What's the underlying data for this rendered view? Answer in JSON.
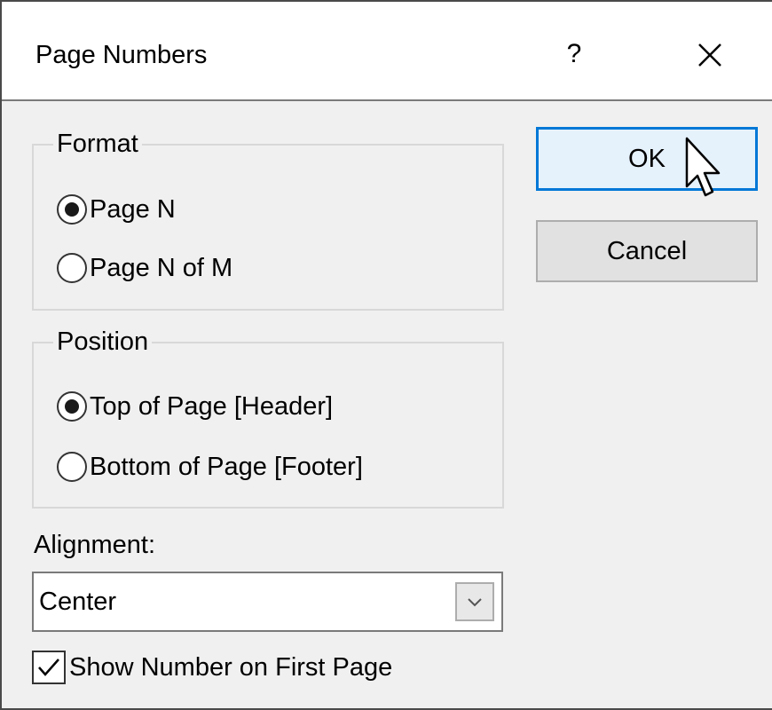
{
  "dialog": {
    "title": "Page Numbers",
    "help_label": "?",
    "close_icon": "close-icon"
  },
  "format_group": {
    "label": "Format",
    "options": [
      {
        "label": "Page N",
        "checked": true
      },
      {
        "label": "Page N of M",
        "checked": false
      }
    ]
  },
  "position_group": {
    "label": "Position",
    "options": [
      {
        "label": "Top of Page [Header]",
        "checked": true
      },
      {
        "label": "Bottom of Page [Footer]",
        "checked": false
      }
    ]
  },
  "alignment": {
    "label": "Alignment:",
    "value": "Center",
    "arrow_icon": "chevron-down-icon"
  },
  "show_first_page": {
    "label": "Show Number on First Page",
    "checked": true
  },
  "buttons": {
    "ok": "OK",
    "cancel": "Cancel"
  },
  "colors": {
    "accent": "#0078d7",
    "window_bg": "#f0f0f0"
  }
}
